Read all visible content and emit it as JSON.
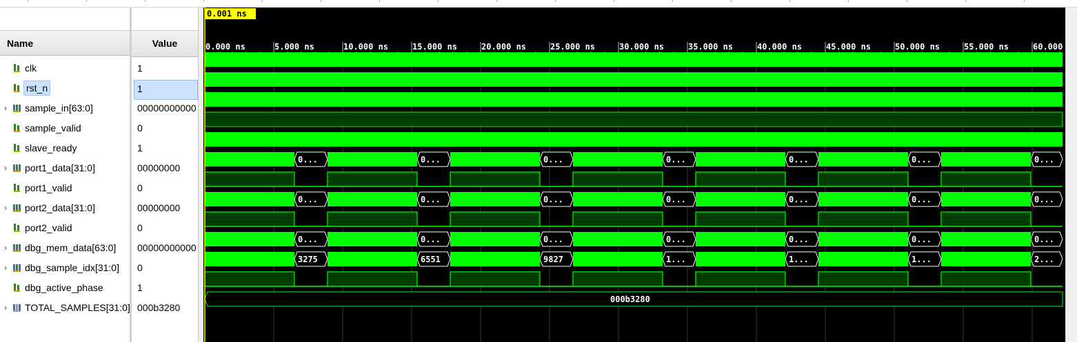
{
  "cursor": {
    "time_label": "0.001 ns"
  },
  "columns": {
    "name": "Name",
    "value": "Value"
  },
  "timeline": {
    "labels": [
      "0.000 ns",
      "5.000 ns",
      "10.000 ns",
      "15.000 ns",
      "20.000 ns",
      "25.000 ns",
      "30.000 ns",
      "35.000 ns",
      "40.000 ns",
      "45.000 ns",
      "50.000 ns",
      "55.000 ns",
      "60.000 ns"
    ]
  },
  "signals": [
    {
      "name": "clk",
      "value": "1",
      "kind": "bit",
      "expandable": false,
      "wave": "high"
    },
    {
      "name": "rst_n",
      "value": "1",
      "kind": "bit",
      "expandable": false,
      "selected": true,
      "wave": "high"
    },
    {
      "name": "sample_in[63:0]",
      "value": "00000000000",
      "kind": "bus",
      "expandable": true,
      "wave": "zero"
    },
    {
      "name": "sample_valid",
      "value": "0",
      "kind": "bit",
      "expandable": false,
      "wave": "low"
    },
    {
      "name": "slave_ready",
      "value": "1",
      "kind": "bit",
      "expandable": false,
      "wave": "high"
    },
    {
      "name": "port1_data[31:0]",
      "value": "00000000",
      "kind": "bus",
      "expandable": true,
      "wave": "burst",
      "labels": [
        "0...",
        "0...",
        "0...",
        "0...",
        "0...",
        "0...",
        "0..."
      ]
    },
    {
      "name": "port1_valid",
      "value": "0",
      "kind": "bit",
      "expandable": false,
      "wave": "phase"
    },
    {
      "name": "port2_data[31:0]",
      "value": "00000000",
      "kind": "bus",
      "expandable": true,
      "wave": "burst",
      "labels": [
        "0...",
        "0...",
        "0...",
        "0...",
        "0...",
        "0...",
        "0..."
      ]
    },
    {
      "name": "port2_valid",
      "value": "0",
      "kind": "bit",
      "expandable": false,
      "wave": "phase"
    },
    {
      "name": "dbg_mem_data[63:0]",
      "value": "00000000000",
      "kind": "bus",
      "expandable": true,
      "wave": "burst",
      "labels": [
        "0...",
        "0...",
        "0...",
        "0...",
        "0...",
        "0...",
        "0..."
      ]
    },
    {
      "name": "dbg_sample_idx[31:0]",
      "value": "0",
      "kind": "bus",
      "expandable": true,
      "wave": "burst",
      "labels": [
        "3275",
        "6551",
        "9827",
        "1...",
        "1...",
        "1...",
        "2..."
      ]
    },
    {
      "name": "dbg_active_phase",
      "value": "1",
      "kind": "bit",
      "expandable": false,
      "wave": "phase"
    },
    {
      "name": "TOTAL_SAMPLES[31:0]",
      "value": "000b3280",
      "kind": "param",
      "expandable": true,
      "wave": "const",
      "labels": [
        "000b3280"
      ]
    }
  ],
  "colors": {
    "wave_green": "#00ff00",
    "low_fill": "#003d00",
    "cursor": "#ffff00",
    "selection": "#cce2ff",
    "bit_icon": "#3a7d2a",
    "bus_icon": "#3d6fb5"
  },
  "icons": {
    "bit": "scalar-signal-icon",
    "bus": "bus-signal-icon",
    "param": "parameter-icon",
    "expand": "chevron-right-icon"
  }
}
